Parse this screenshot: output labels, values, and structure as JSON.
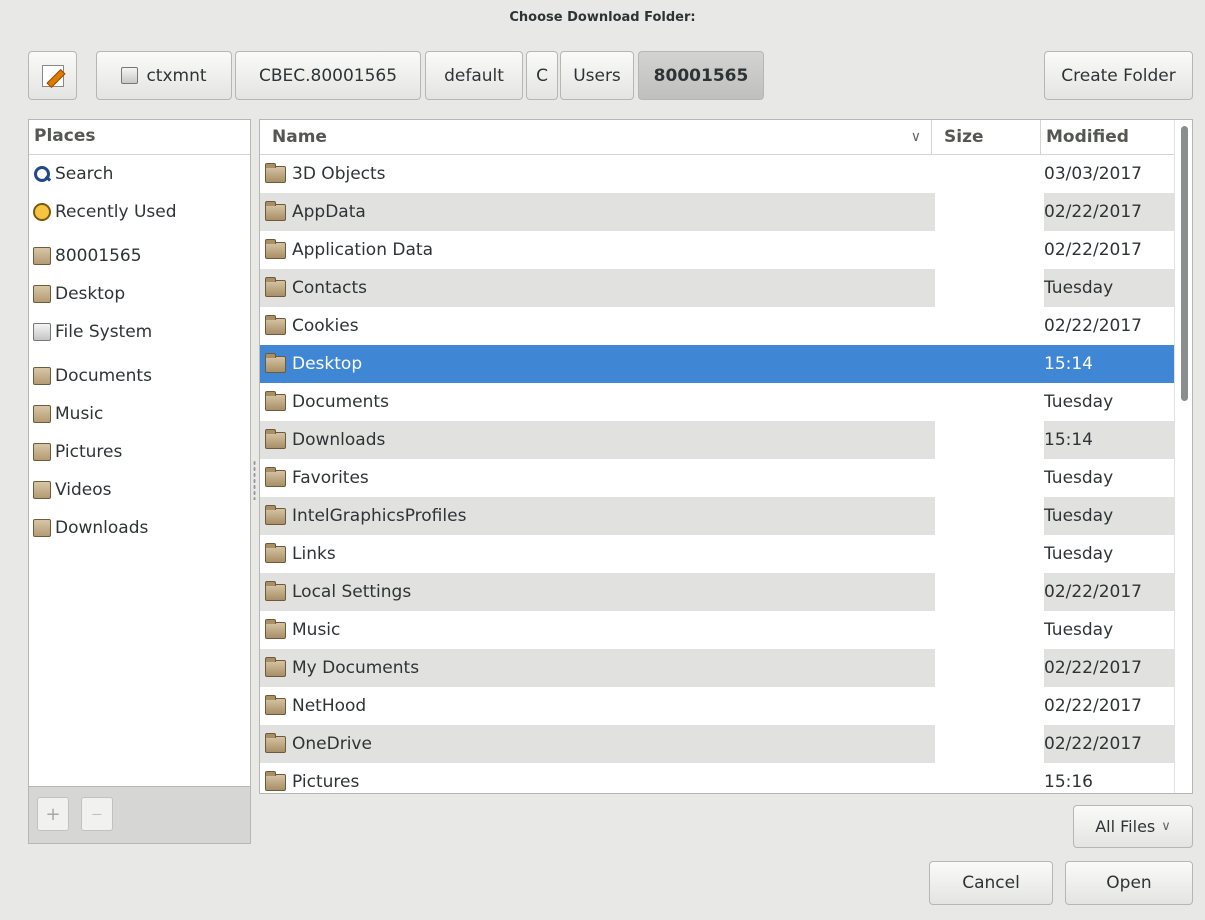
{
  "dialog": {
    "title": "Choose Download Folder:"
  },
  "path_bar": {
    "crumbs": [
      "ctxmnt",
      "CBEC.80001565",
      "default",
      "C",
      "Users",
      "80001565"
    ],
    "active_index": 5,
    "create_folder_label": "Create Folder"
  },
  "places": {
    "header": "Places",
    "items": [
      {
        "label": "Search",
        "icon": "search-icon"
      },
      {
        "label": "Recently Used",
        "icon": "clock-icon"
      },
      {
        "label": "80001565",
        "icon": "home-folder-icon"
      },
      {
        "label": "Desktop",
        "icon": "desktop-folder-icon"
      },
      {
        "label": "File System",
        "icon": "drive-icon"
      },
      {
        "label": "Documents",
        "icon": "documents-folder-icon"
      },
      {
        "label": "Music",
        "icon": "music-folder-icon"
      },
      {
        "label": "Pictures",
        "icon": "pictures-folder-icon"
      },
      {
        "label": "Videos",
        "icon": "videos-folder-icon"
      },
      {
        "label": "Downloads",
        "icon": "downloads-folder-icon"
      }
    ],
    "add_label": "+",
    "remove_label": "—"
  },
  "files": {
    "columns": {
      "name": "Name",
      "size": "Size",
      "modified": "Modified"
    },
    "selected_index": 5,
    "rows": [
      {
        "name": "3D Objects",
        "modified": "03/03/2017"
      },
      {
        "name": "AppData",
        "modified": "02/22/2017"
      },
      {
        "name": "Application Data",
        "modified": "02/22/2017"
      },
      {
        "name": "Contacts",
        "modified": "Tuesday"
      },
      {
        "name": "Cookies",
        "modified": "02/22/2017"
      },
      {
        "name": "Desktop",
        "modified": "15:14"
      },
      {
        "name": "Documents",
        "modified": "Tuesday"
      },
      {
        "name": "Downloads",
        "modified": "15:14"
      },
      {
        "name": "Favorites",
        "modified": "Tuesday"
      },
      {
        "name": "IntelGraphicsProfiles",
        "modified": "Tuesday"
      },
      {
        "name": "Links",
        "modified": "Tuesday"
      },
      {
        "name": "Local Settings",
        "modified": "02/22/2017"
      },
      {
        "name": "Music",
        "modified": "Tuesday"
      },
      {
        "name": "My Documents",
        "modified": "02/22/2017"
      },
      {
        "name": "NetHood",
        "modified": "02/22/2017"
      },
      {
        "name": "OneDrive",
        "modified": "02/22/2017"
      },
      {
        "name": "Pictures",
        "modified": "15:16"
      }
    ]
  },
  "filter": {
    "label": "All Files"
  },
  "actions": {
    "cancel_label": "Cancel",
    "open_label": "Open"
  },
  "colors": {
    "selection": "#3f86d4",
    "alt_row": "#e1e1df",
    "background": "#e8e8e7"
  }
}
